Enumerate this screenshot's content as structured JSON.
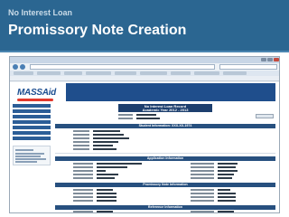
{
  "slide": {
    "subtitle": "No Interest Loan",
    "title": "Promissory Note Creation"
  },
  "screenshot": {
    "record_title_line1": "No Interest Loan Record",
    "record_title_line2": "Academic Year 2012 - 2013",
    "section_student": "Student Information: XXX-XX-1974",
    "section_application": "Application Information",
    "section_promissory": "Promissory Note Information",
    "section_reference": "Reference Information",
    "logo_text": "MASSAid",
    "sidebar_items": [
      "Find a Loan/Withdraw",
      "MEFA Info",
      "NIL Information",
      "No Interest Loan Tracker",
      "Loan History",
      "Student Profile",
      "Help & Resources"
    ]
  },
  "colors": {
    "header_blue": "#2b6691",
    "section_bar": "#27507f",
    "sidebar_blue": "#2c5e97"
  }
}
